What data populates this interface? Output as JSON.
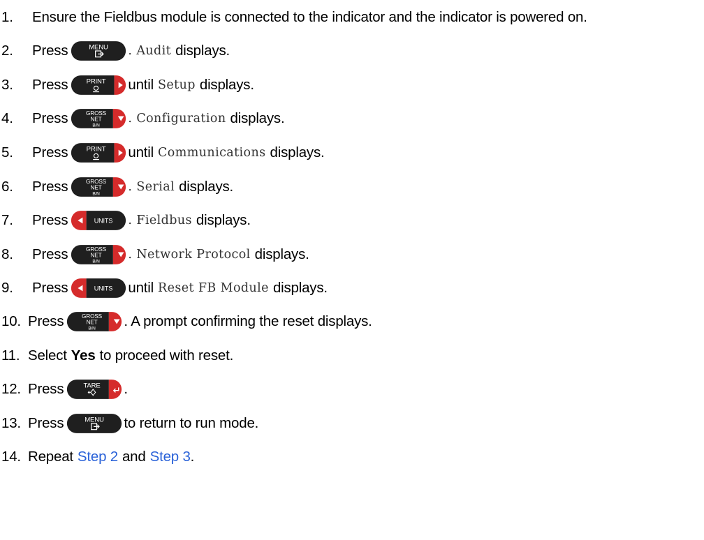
{
  "keys": {
    "menu": {
      "label": "MENU"
    },
    "print": {
      "label": "PRINT"
    },
    "gross": {
      "line1": "GROSS",
      "line2": "NET",
      "line3": "B/N"
    },
    "units": {
      "label": "UNITS"
    },
    "tare": {
      "label": "TARE"
    }
  },
  "steps": [
    {
      "num": "1.",
      "text": "Ensure the Fieldbus module is connected to the indicator and the indicator is powered on."
    },
    {
      "num": "2.",
      "pre": "Press",
      "code": ". Audit",
      "post": "displays."
    },
    {
      "num": "3.",
      "pre": "Press",
      "mid": "until",
      "code": "Setup",
      "post": "displays."
    },
    {
      "num": "4.",
      "pre": "Press",
      "code": ". Configuration",
      "post": "displays."
    },
    {
      "num": "5.",
      "pre": "Press",
      "mid": "until",
      "code": "Communications",
      "post": "displays."
    },
    {
      "num": "6.",
      "pre": "Press",
      "code": ". Serial",
      "post": "displays."
    },
    {
      "num": "7.",
      "pre": "Press",
      "code": ". Fieldbus",
      "post": "displays."
    },
    {
      "num": "8.",
      "pre": "Press",
      "code": ". Network Protocol",
      "post": "displays."
    },
    {
      "num": "9.",
      "pre": "Press",
      "mid": "until",
      "code": "Reset FB Module",
      "post": "displays."
    },
    {
      "num": "10.",
      "pre": "Press",
      "post": ". A prompt confirming the reset displays."
    },
    {
      "num": "11.",
      "pre": "Select",
      "bold": "Yes",
      "post": "to proceed with reset."
    },
    {
      "num": "12.",
      "pre": "Press",
      "post": "."
    },
    {
      "num": "13.",
      "pre": "Press",
      "post": "to return to run mode."
    },
    {
      "num": "14.",
      "pre": "Repeat",
      "link1": "Step 2",
      "and": "and",
      "link2": "Step 3",
      "end": "."
    }
  ]
}
